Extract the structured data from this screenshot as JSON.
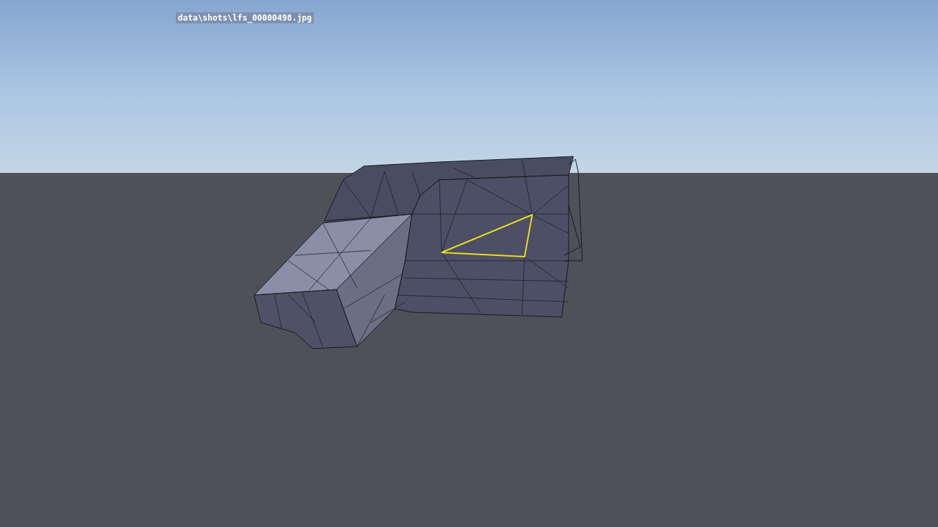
{
  "viewport": {
    "filename_label": "data\\shots\\lfs_00000498.jpg"
  }
}
